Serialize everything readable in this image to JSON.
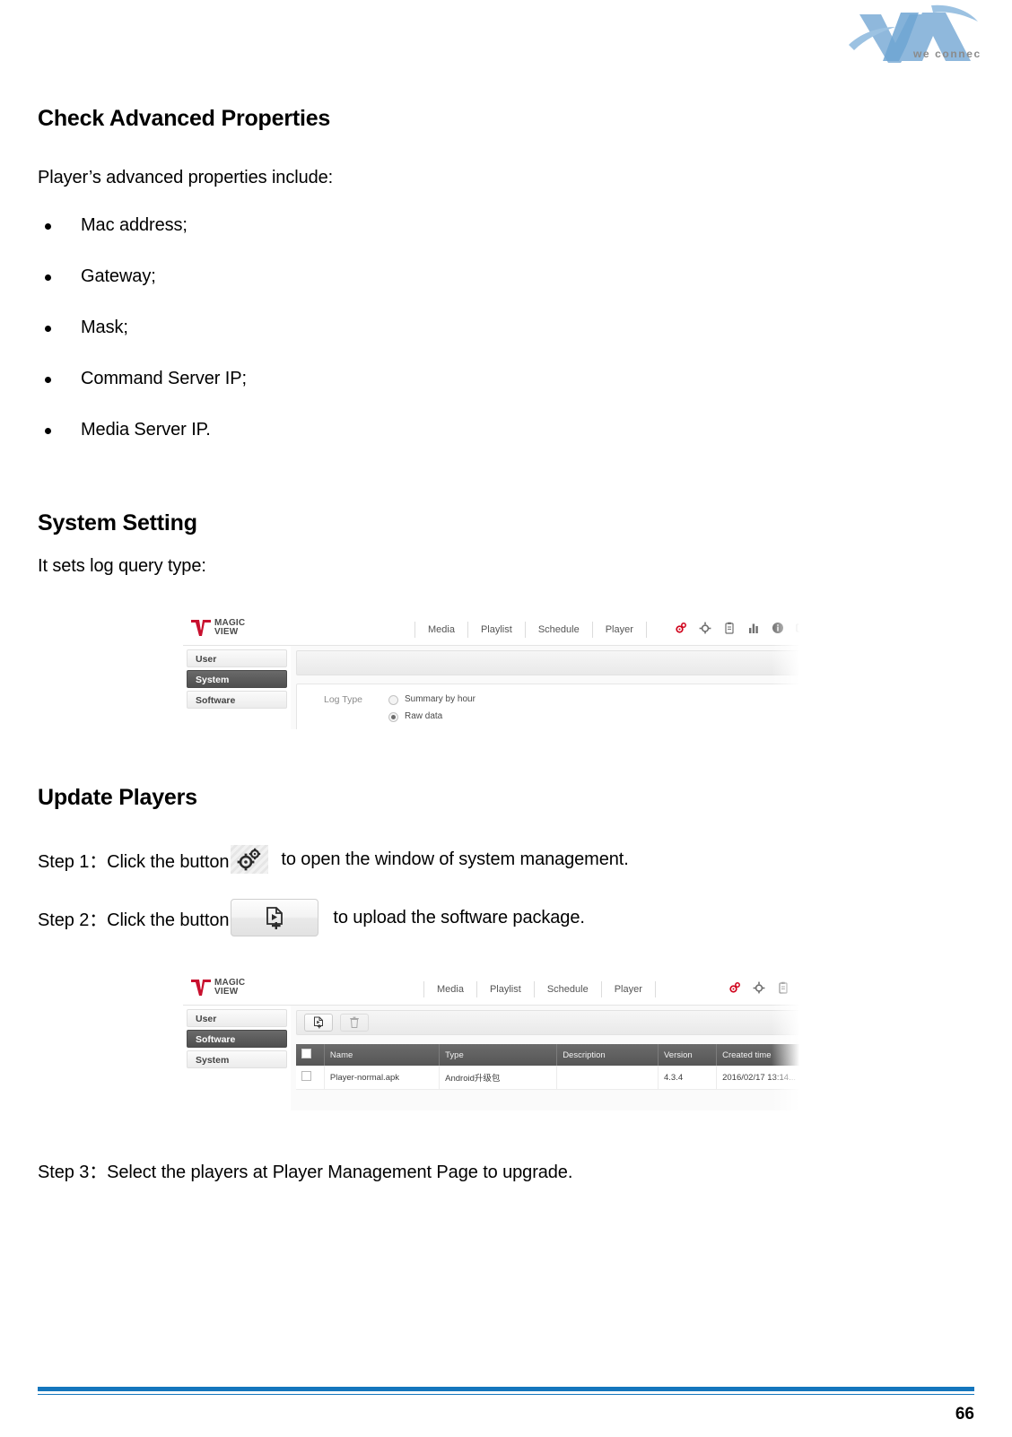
{
  "brand": {
    "logo_text": "VIA",
    "tagline": "we connect"
  },
  "sections": {
    "check_advanced": {
      "heading": "Check Advanced Properties",
      "intro": "Player’s advanced properties include:",
      "bullets": [
        "Mac address;",
        "Gateway;",
        "Mask;",
        "Command Server IP;",
        "Media Server IP."
      ]
    },
    "system_setting": {
      "heading": "System Setting",
      "intro": "It sets log query type:"
    },
    "update_players": {
      "heading": "Update Players",
      "step1_before": "Step 1：Click the button",
      "step1_after": "to open the window of system management.",
      "step2_before": "Step 2：Click the button",
      "step2_after": "to upload the software package.",
      "step3": "Step 3：Select the players at Player Management Page to upgrade."
    }
  },
  "screenshot_system": {
    "logo": {
      "line1": "MAGIC",
      "line2": "VIEW"
    },
    "nav": [
      "Media",
      "Playlist",
      "Schedule",
      "Player"
    ],
    "icons": [
      "gears-red-icon",
      "gear-icon",
      "clipboard-icon",
      "bar-chart-icon",
      "info-icon",
      "monitor-icon"
    ],
    "sidebar": [
      {
        "label": "User",
        "active": false
      },
      {
        "label": "System",
        "active": true
      },
      {
        "label": "Software",
        "active": false
      }
    ],
    "log_type_label": "Log Type",
    "log_type_options": [
      {
        "label": "Summary by hour",
        "selected": false
      },
      {
        "label": "Raw data",
        "selected": true
      }
    ]
  },
  "screenshot_software": {
    "logo": {
      "line1": "MAGIC",
      "line2": "VIEW"
    },
    "nav": [
      "Media",
      "Playlist",
      "Schedule",
      "Player"
    ],
    "icons": [
      "gears-red-icon",
      "gear-icon",
      "clipboard-icon"
    ],
    "sidebar": [
      {
        "label": "User",
        "active": false
      },
      {
        "label": "Software",
        "active": true
      },
      {
        "label": "System",
        "active": false
      }
    ],
    "toolbar_buttons": [
      "upload-file-icon",
      "trash-icon"
    ],
    "table": {
      "columns": [
        "",
        "Name",
        "Type",
        "Description",
        "Version",
        "Created time"
      ],
      "rows": [
        {
          "name": "Player-normal.apk",
          "type": "Android升级包",
          "description": "",
          "version": "4.3.4",
          "created_time": "2016/02/17 13:14..."
        }
      ]
    }
  },
  "footer": {
    "page_number": "66"
  },
  "colors": {
    "footer_rule": "#1476bd",
    "logo_blue": "#7fb2db",
    "accent_red": "#d0021b",
    "active_sidebar": "#5a5a5a"
  }
}
